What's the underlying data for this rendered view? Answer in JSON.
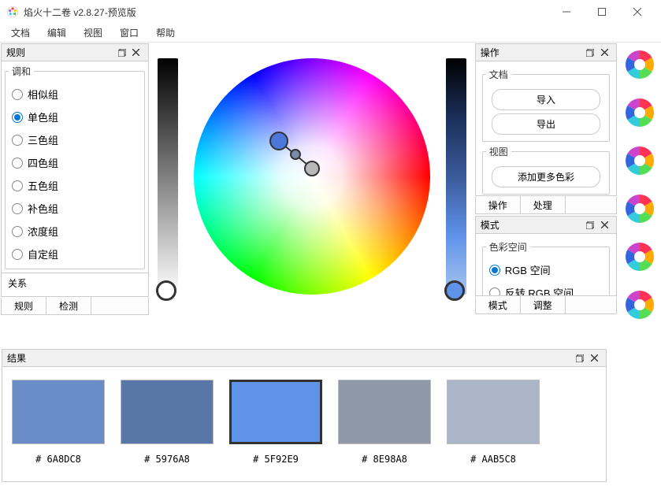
{
  "window": {
    "title": "焰火十二卷 v2.8.27-预览版"
  },
  "menubar": [
    "文档",
    "编辑",
    "视图",
    "窗口",
    "帮助"
  ],
  "panels": {
    "rules": {
      "title": "规则",
      "harmony_legend": "调和",
      "relation": "关系",
      "options": [
        "相似组",
        "单色组",
        "三色组",
        "四色组",
        "五色组",
        "补色组",
        "浓度组",
        "自定组"
      ],
      "selected_index": 1,
      "tabs": [
        "规则",
        "检测"
      ]
    },
    "ops": {
      "title": "操作",
      "doc_legend": "文档",
      "import": "导入",
      "export": "导出",
      "view_legend": "视图",
      "add_more": "添加更多色彩",
      "tabs": [
        "操作",
        "处理"
      ]
    },
    "mode": {
      "title": "模式",
      "space_legend": "色彩空间",
      "options": [
        "RGB 空间",
        "反转 RGB 空间"
      ],
      "selected_index": 0,
      "tabs": [
        "模式",
        "调整"
      ]
    },
    "results": {
      "title": "结果",
      "swatches": [
        {
          "hex": "6A8DC8",
          "color": "#6A8DC8"
        },
        {
          "hex": "5976A8",
          "color": "#5976A8"
        },
        {
          "hex": "5F92E9",
          "color": "#5F92E9"
        },
        {
          "hex": "8E98A8",
          "color": "#8E98A8"
        },
        {
          "hex": "AAB5C8",
          "color": "#AAB5C8"
        }
      ],
      "selected_index": 2
    }
  },
  "hash": "#"
}
